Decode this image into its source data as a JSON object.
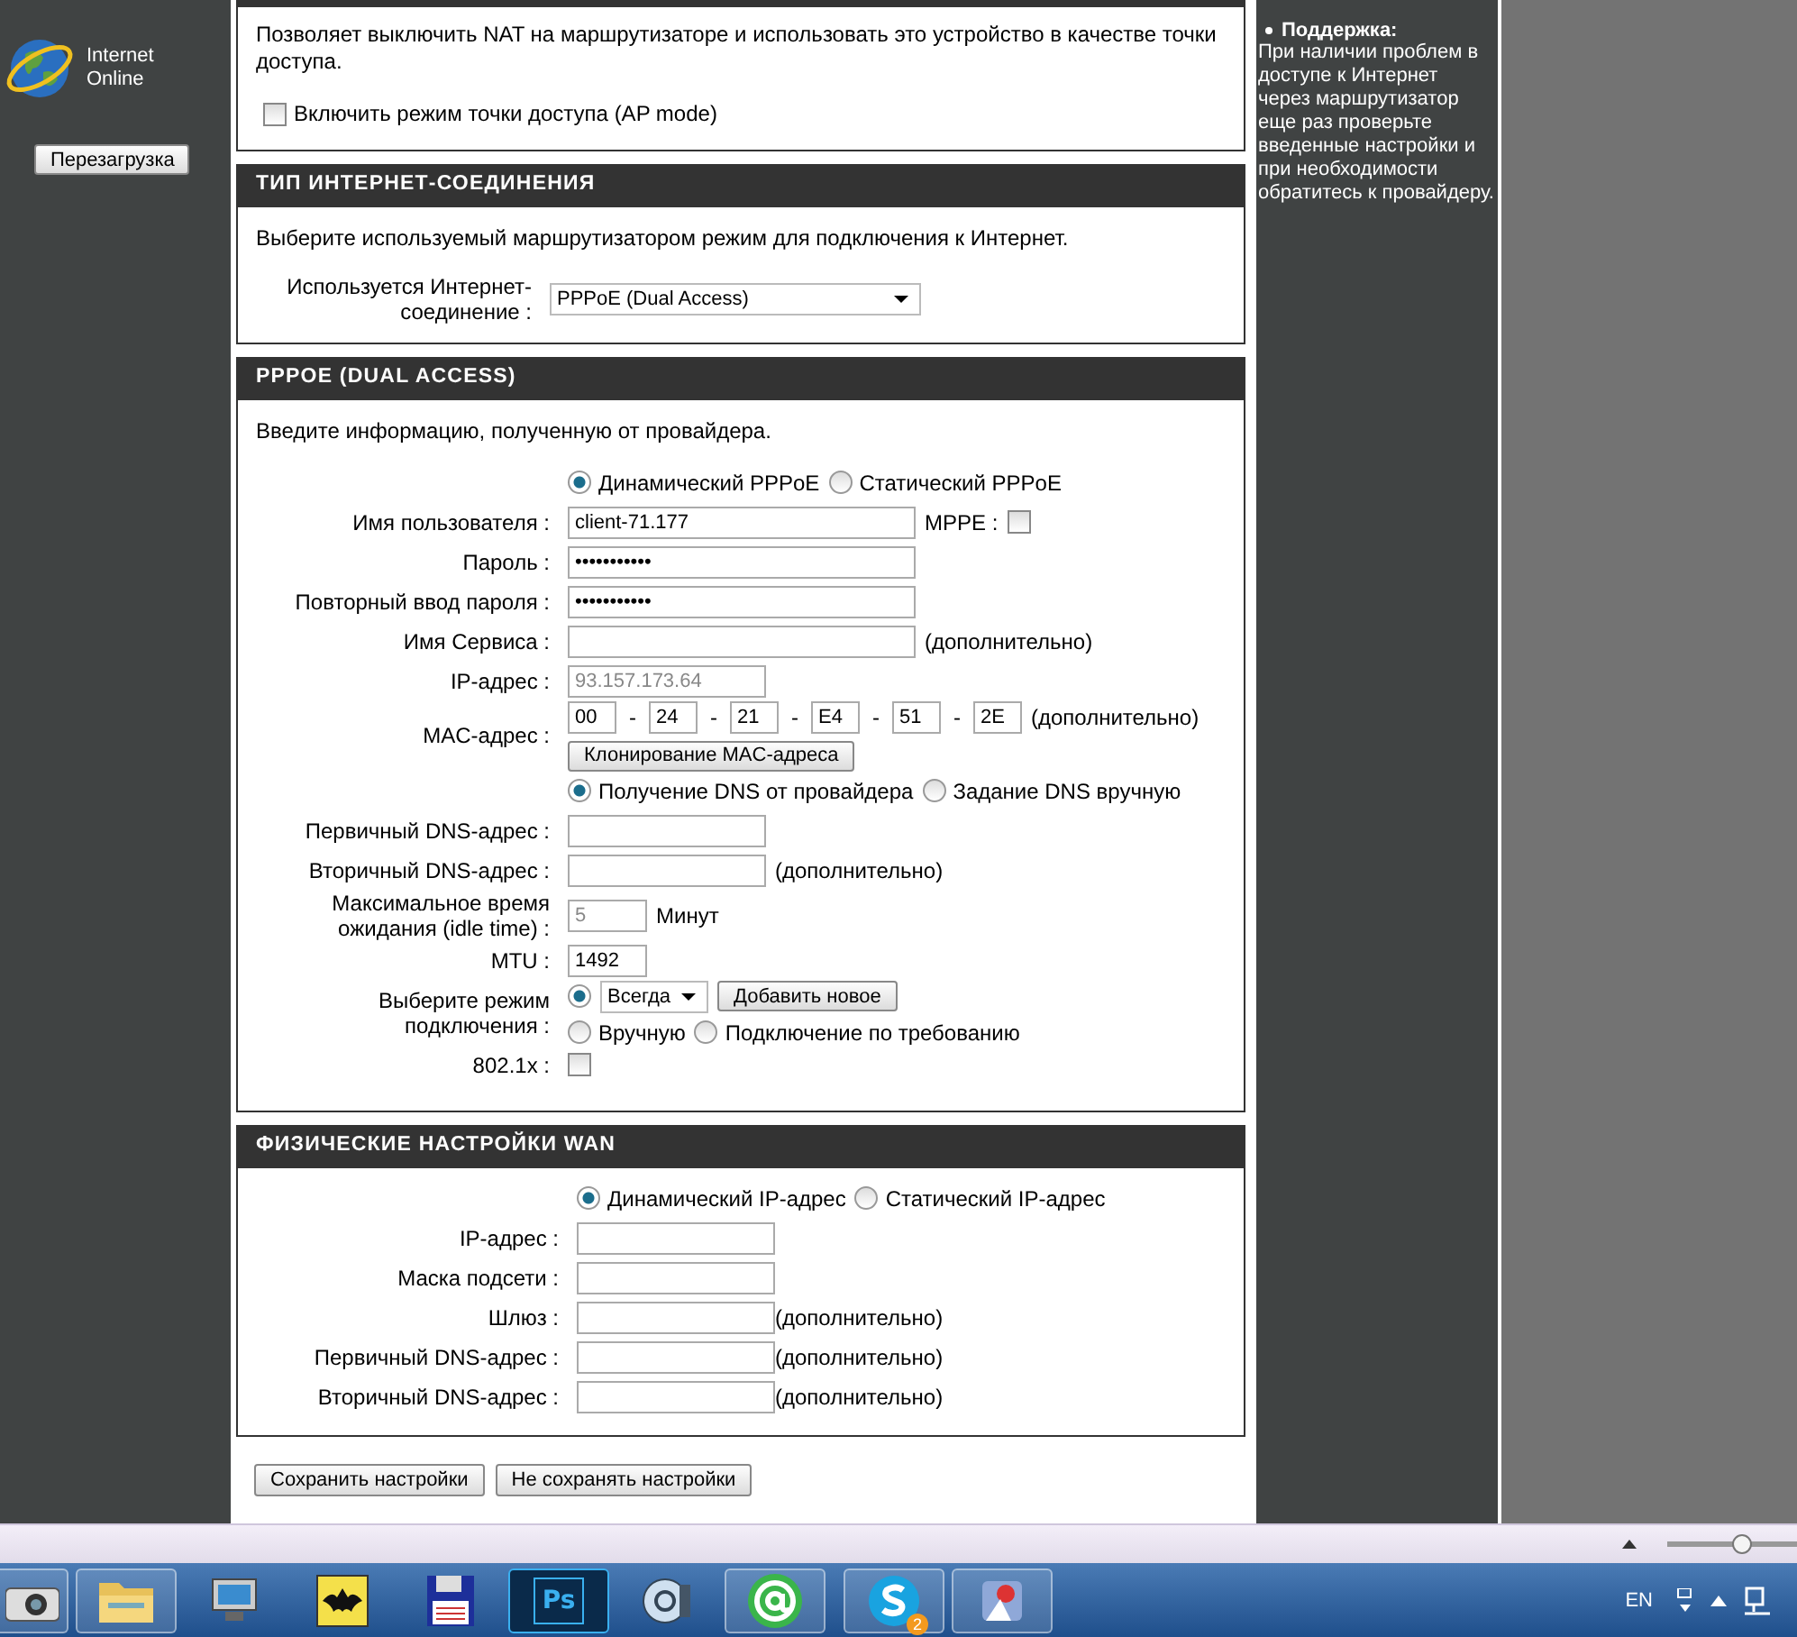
{
  "sidebar": {
    "status": "Internet Online",
    "reboot_button": "Перезагрузка"
  },
  "ap_section": {
    "description": "Позволяет выключить NAT на маршрутизаторе и использовать это устройство в качестве точки доступа.",
    "ap_mode": {
      "label": "Включить режим точки доступа (AP mode)",
      "checked": false
    }
  },
  "connection_type": {
    "title": "ТИП ИНТЕРНЕТ-СОЕДИНЕНИЯ",
    "description": "Выберите используемый маршрутизатором режим для подключения к Интернет.",
    "label": "Используется Интернет-соединение :",
    "value": "PPPoE (Dual Access)"
  },
  "pppoe": {
    "title": "PPPOE (DUAL ACCESS)",
    "description": "Введите информацию, полученную от провайдера.",
    "rows": [
      {
        "items": [
          {
            "kind": "radio",
            "label": "Динамический PPPoE",
            "selected": true
          },
          {
            "kind": "radio",
            "label": "Статический PPPoE",
            "selected": false
          }
        ]
      },
      {
        "label": "Имя пользователя :",
        "items": [
          {
            "kind": "long_input",
            "value": "client-71.177"
          },
          {
            "kind": "note",
            "text": "MPPE :"
          },
          {
            "kind": "checkbox",
            "checked": false
          }
        ]
      },
      {
        "label": "Пароль :",
        "items": [
          {
            "kind": "long_input",
            "value": "•••••••••••"
          }
        ]
      },
      {
        "label": "Повторный ввод пароля :",
        "items": [
          {
            "kind": "long_input",
            "value": "•••••••••••"
          }
        ]
      },
      {
        "label": "Имя Сервиса :",
        "items": [
          {
            "kind": "long_input"
          },
          {
            "kind": "note",
            "text": "(дополнительно)"
          }
        ]
      },
      {
        "label": "IP-адрес :",
        "items": [
          {
            "kind": "input",
            "value": "93.157.173.64",
            "disabled": true
          }
        ]
      },
      {
        "label": "MAC-адрес :",
        "items": [
          {
            "kind": "mac_input",
            "value": "00"
          },
          {
            "kind": "separator",
            "text": "-"
          },
          {
            "kind": "mac_input",
            "value": "24"
          },
          {
            "kind": "separator",
            "text": "-"
          },
          {
            "kind": "mac_input",
            "value": "21"
          },
          {
            "kind": "separator",
            "text": "-"
          },
          {
            "kind": "mac_input",
            "value": "E4"
          },
          {
            "kind": "separator",
            "text": "-"
          },
          {
            "kind": "mac_input",
            "value": "51"
          },
          {
            "kind": "separator",
            "text": "-"
          },
          {
            "kind": "mac_input",
            "value": "2E"
          },
          {
            "kind": "note",
            "text": "(дополнительно)"
          },
          {
            "kind": "break"
          },
          {
            "kind": "button",
            "label": "Клонирование MAC-адреса"
          }
        ]
      },
      {
        "items": [
          {
            "kind": "radio",
            "label": "Получение DNS от провайдера",
            "selected": true
          },
          {
            "kind": "radio",
            "label": "Задание DNS вручную",
            "selected": false
          }
        ]
      },
      {
        "label": "Первичный DNS-адрес :",
        "items": [
          {
            "kind": "input"
          }
        ]
      },
      {
        "label": "Вторичный DNS-адрес :",
        "items": [
          {
            "kind": "input"
          },
          {
            "kind": "note",
            "text": "(дополнительно)"
          }
        ]
      },
      {
        "label": "Максимальное время ожидания (idle time) :",
        "items": [
          {
            "kind": "short_input",
            "value": "5",
            "disabled": true
          },
          {
            "kind": "note",
            "text": "Минут"
          }
        ]
      },
      {
        "label": "MTU :",
        "items": [
          {
            "kind": "short_input",
            "value": "1492"
          }
        ]
      },
      {
        "label": "Выберите режим подключения :",
        "items": [
          {
            "kind": "radio",
            "selected": true
          },
          {
            "kind": "select",
            "value": "Всегда"
          },
          {
            "kind": "button",
            "label": "Добавить новое"
          },
          {
            "kind": "break"
          },
          {
            "kind": "radio",
            "label": "Вручную",
            "selected": false
          },
          {
            "kind": "radio",
            "label": "Подключение по требованию",
            "selected": false
          }
        ]
      },
      {
        "label": "802.1x :",
        "items": [
          {
            "kind": "checkbox",
            "checked": false
          }
        ]
      }
    ]
  },
  "wan": {
    "title": "ФИЗИЧЕСКИЕ НАСТРОЙКИ WAN",
    "rows": [
      {
        "items": [
          {
            "kind": "radio",
            "label": "Динамический IP-адрес",
            "selected": true
          },
          {
            "kind": "radio",
            "label": "Статический IP-адрес",
            "selected": false
          }
        ]
      },
      {
        "label": "IP-адрес :",
        "items": [
          {
            "kind": "input"
          }
        ]
      },
      {
        "label": "Маска подсети :",
        "items": [
          {
            "kind": "input"
          }
        ]
      },
      {
        "label": "Шлюз :",
        "items": [
          {
            "kind": "input"
          },
          {
            "kind": "tight_note",
            "text": "(дополнительно)"
          }
        ]
      },
      {
        "label": "Первичный DNS-адрес :",
        "items": [
          {
            "kind": "input"
          },
          {
            "kind": "tight_note",
            "text": "(дополнительно)"
          }
        ]
      },
      {
        "label": "Вторичный DNS-адрес :",
        "items": [
          {
            "kind": "input"
          },
          {
            "kind": "tight_note",
            "text": "(дополнительно)"
          }
        ]
      }
    ]
  },
  "actions": [
    "Сохранить настройки",
    "Не сохранять настройки"
  ],
  "help": {
    "title": "Поддержка:",
    "text": "При наличии проблем в доступе к Интернет через маршрутизатор еще раз проверьте введенные настройки и при необходимости обратитесь к провайдеру."
  },
  "browser_status": {
    "zoom_slider": {
      "level": 0.57
    }
  },
  "taskbar": {
    "apps": [
      {
        "kind": "camera",
        "running": true
      },
      {
        "kind": "folder",
        "running": true
      },
      {
        "kind": "monitor",
        "running": false
      },
      {
        "kind": "bat",
        "running": false
      },
      {
        "kind": "floppy",
        "running": false
      },
      {
        "kind": "ps",
        "label": "Ps",
        "running": false
      },
      {
        "kind": "media",
        "running": false
      },
      {
        "kind": "at",
        "running": true
      },
      {
        "kind": "skype",
        "badge": "2",
        "running": true
      },
      {
        "kind": "launcher",
        "running": true
      }
    ],
    "language": "EN"
  }
}
